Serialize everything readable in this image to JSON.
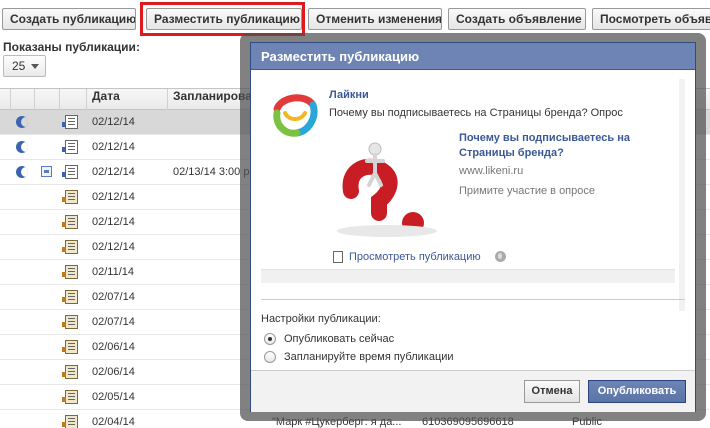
{
  "toolbar": {
    "create_post": "Создать публикацию",
    "publish_post": "Разместить публикацию",
    "undo_changes": "Отменить изменения",
    "create_ad": "Создать объявление",
    "view_ad": "Посмотреть объявл"
  },
  "list": {
    "shown_label": "Показаны публикации:",
    "page_size": "25",
    "headers": {
      "date": "Дата",
      "scheduled": "Запланирова",
      "right_partial": "Я"
    },
    "rows": [
      {
        "date": "02/12/14",
        "scheduled": "",
        "moon": true,
        "cal": false,
        "ad": false,
        "selected": true
      },
      {
        "date": "02/12/14",
        "scheduled": "",
        "moon": true,
        "cal": false,
        "ad": false,
        "selected": false
      },
      {
        "date": "02/12/14",
        "scheduled": "02/13/14 3:00 p",
        "moon": true,
        "cal": true,
        "ad": false,
        "selected": false
      },
      {
        "date": "02/12/14",
        "scheduled": "",
        "moon": false,
        "cal": false,
        "ad": true,
        "selected": false
      },
      {
        "date": "02/12/14",
        "scheduled": "",
        "moon": false,
        "cal": false,
        "ad": true,
        "selected": false
      },
      {
        "date": "02/12/14",
        "scheduled": "",
        "moon": false,
        "cal": false,
        "ad": true,
        "selected": false
      },
      {
        "date": "02/11/14",
        "scheduled": "",
        "moon": false,
        "cal": false,
        "ad": true,
        "selected": false
      },
      {
        "date": "02/07/14",
        "scheduled": "",
        "moon": false,
        "cal": false,
        "ad": true,
        "selected": false
      },
      {
        "date": "02/07/14",
        "scheduled": "",
        "moon": false,
        "cal": false,
        "ad": true,
        "selected": false
      },
      {
        "date": "02/06/14",
        "scheduled": "",
        "moon": false,
        "cal": false,
        "ad": true,
        "selected": false
      },
      {
        "date": "02/06/14",
        "scheduled": "",
        "moon": false,
        "cal": false,
        "ad": true,
        "selected": false
      },
      {
        "date": "02/05/14",
        "scheduled": "",
        "moon": false,
        "cal": false,
        "ad": true,
        "selected": false
      },
      {
        "date": "02/04/14",
        "scheduled": "",
        "moon": false,
        "cal": false,
        "ad": true,
        "selected": false
      }
    ],
    "last_row_extra": {
      "title": "\"Марк #Цукерберг: я да...",
      "id": "610369095696618",
      "visibility": "Public"
    }
  },
  "dialog": {
    "title": "Разместить публикацию",
    "page_name": "Лайкни",
    "post_text": "Почему вы подписываетесь на Страницы бренда? Опрос",
    "link_title": "Почему вы подписываетесь на Страницы бренда?",
    "link_url": "www.likeni.ru",
    "link_desc": "Примите участие в опросе",
    "view_post": "Просмотреть публикацию",
    "settings_label": "Настройки публикации:",
    "options": [
      {
        "label": "Опубликовать сейчас",
        "selected": true
      },
      {
        "label": "Запланируйте время публикации",
        "selected": false
      }
    ],
    "cancel": "Отмена",
    "publish": "Опубликовать"
  },
  "colors": {
    "accent": "#3b5998",
    "title_bar": "#6d84b4",
    "highlight": "#e0191e"
  }
}
